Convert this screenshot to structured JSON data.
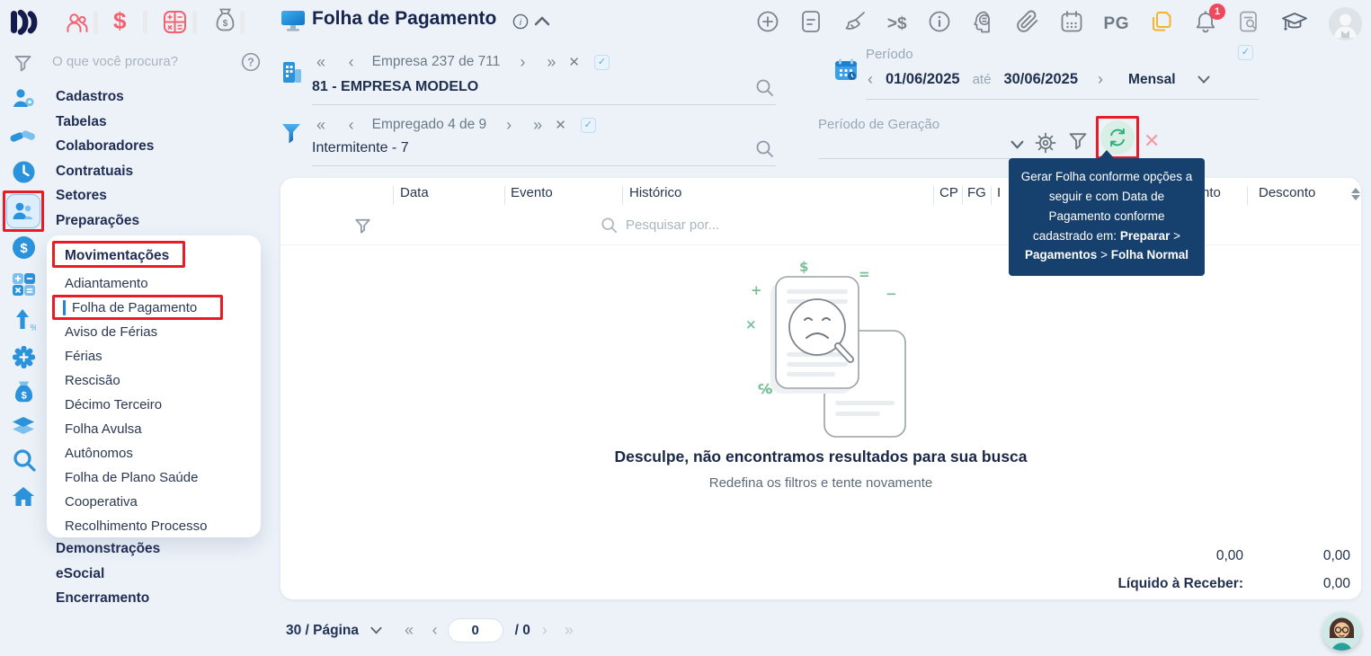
{
  "topbar": {
    "quick_icons": [
      "people-icon",
      "dollar-icon",
      "calculator-icon",
      "money-bag-icon"
    ],
    "title": "Folha de Pagamento",
    "right_icons": [
      "plus-circle-icon",
      "document-icon",
      "broom-icon",
      "greater-dollar-icon",
      "info-circle-icon",
      "head-calc-icon",
      "paperclip-icon",
      "calendar-icon",
      "pg-label",
      "note-icon",
      "bell-icon",
      "document-search-icon",
      "graduation-cap-icon",
      "user-avatar"
    ],
    "pg_label": "PG",
    "greater_dollar_label": ">$",
    "notification_count": "1"
  },
  "sidebar": {
    "search_placeholder": "O que você procura?",
    "menu_top": [
      "Cadastros",
      "Tabelas",
      "Colaboradores",
      "Contratuais",
      "Setores",
      "Preparações"
    ],
    "submenu_title": "Movimentações",
    "submenu_items": [
      "Adiantamento",
      "Folha de Pagamento",
      "Aviso de Férias",
      "Férias",
      "Rescisão",
      "Décimo Terceiro",
      "Folha Avulsa",
      "Autônomos",
      "Folha de Plano Saúde",
      "Cooperativa",
      "Recolhimento Processo"
    ],
    "submenu_active": "Folha de Pagamento",
    "menu_bottom": [
      "Demonstrações",
      "eSocial",
      "Encerramento"
    ]
  },
  "selectors": {
    "company": {
      "nav_label": "Empresa 237 de 711",
      "value": "81 - EMPRESA MODELO"
    },
    "employee": {
      "nav_label": "Empregado 4 de 9",
      "value": "Intermitente - 7"
    },
    "period": {
      "label": "Período",
      "start_date": "01/06/2025",
      "separator": "até",
      "end_date": "30/06/2025",
      "mode": "Mensal"
    },
    "generation_period": {
      "label": "Período de Geração"
    }
  },
  "tooltip": {
    "segments": [
      {
        "text": "Gerar Folha conforme opções a seguir e com Data de Pagamento conforme cadastrado em: ",
        "bold": false
      },
      {
        "text": "Preparar",
        "bold": true
      },
      {
        "text": " > ",
        "bold": false
      },
      {
        "text": "Pagamentos",
        "bold": true
      },
      {
        "text": " > ",
        "bold": false
      },
      {
        "text": "Folha Normal",
        "bold": true
      }
    ]
  },
  "table": {
    "columns": [
      "Data",
      "Evento",
      "Histórico",
      "CP",
      "FG",
      "I",
      "nto",
      "Desconto"
    ],
    "search_placeholder": "Pesquisar por..."
  },
  "empty_state": {
    "title": "Desculpe, não encontramos resultados para sua busca",
    "subtitle": "Redefina os filtros e tente novamente"
  },
  "totals": {
    "row1_value_a": "0,00",
    "row1_value_b": "0,00",
    "liquid_label": "Líquido à Receber:",
    "liquid_value": "0,00"
  },
  "pagination": {
    "page_size_label": "30 / Página",
    "page_input": "0",
    "total_label": "/ 0"
  },
  "colors": {
    "accent_blue": "#2b92dc",
    "alert_red": "#e81b26",
    "pink": "#f4626f",
    "green": "#2fae7f",
    "tooltip_bg": "#16406e",
    "navy": "#1b2950"
  }
}
